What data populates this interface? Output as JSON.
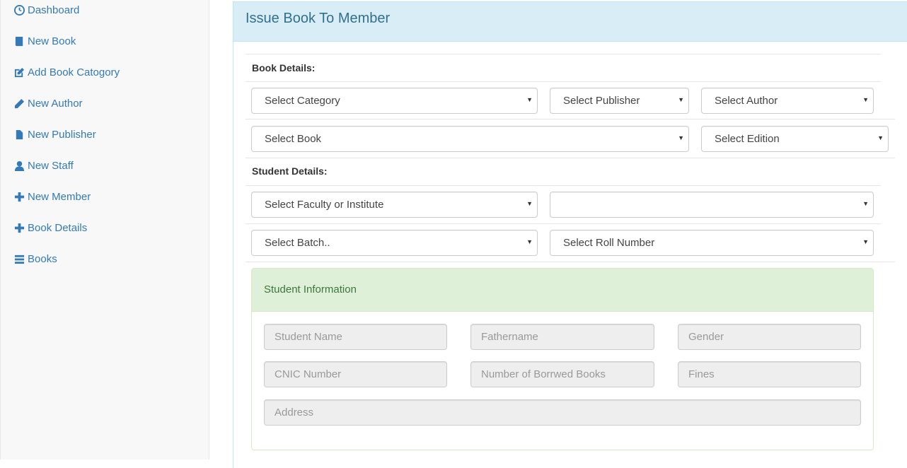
{
  "sidebar": {
    "items": [
      {
        "label": "Dashboard",
        "icon": "dashboard-icon"
      },
      {
        "label": "New Book",
        "icon": "book-icon"
      },
      {
        "label": "Add Book Catogory",
        "icon": "edit-icon"
      },
      {
        "label": "New Author",
        "icon": "pencil-icon"
      },
      {
        "label": "New Publisher",
        "icon": "file-icon"
      },
      {
        "label": "New Staff",
        "icon": "user-icon"
      },
      {
        "label": "New Member",
        "icon": "plus-icon"
      },
      {
        "label": "Book Details",
        "icon": "plus-icon"
      },
      {
        "label": "Books",
        "icon": "list-icon"
      }
    ]
  },
  "panel": {
    "title": "Issue Book To Member",
    "book_section": "Book Details:",
    "student_section": "Student Details:",
    "selects": {
      "category": "Select Category",
      "publisher": "Select Publisher",
      "author": "Select Author",
      "book": "Select Book",
      "edition": "Select Edition",
      "faculty": "Select Faculty or Institute",
      "department": "",
      "batch": "Select Batch..",
      "roll": "Select Roll Number"
    }
  },
  "student_info": {
    "title": "Student Information",
    "fields": {
      "name": "Student Name",
      "father": "Fathername",
      "gender": "Gender",
      "cnic": "CNIC Number",
      "borrowed": "Number of Borrwed Books",
      "fines": "Fines",
      "address": "Address"
    }
  },
  "colors": {
    "link": "#337ab7",
    "heading_bg": "#d9edf7",
    "heading_text": "#31708f",
    "success_bg": "#dff0d8",
    "success_text": "#3c763d"
  }
}
